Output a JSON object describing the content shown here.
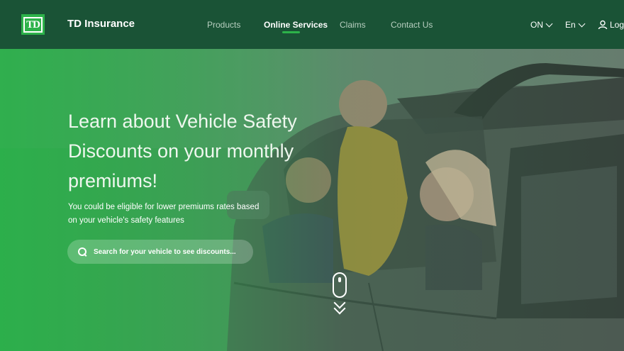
{
  "nav": {
    "logo_text": "TD",
    "brand": "TD Insurance",
    "links": [
      {
        "label": "Products"
      },
      {
        "label": "Online Services"
      },
      {
        "label": "Claims"
      },
      {
        "label": "Contact Us"
      }
    ],
    "province": "ON",
    "language": "En",
    "login": "Log"
  },
  "hero": {
    "headline": "Learn about Vehicle Safety Discounts on your monthly premiums!",
    "subtext": "You could be eligible for lower premiums rates based on your vehicle's safety features",
    "search_placeholder": "Search for your vehicle to see discounts..."
  },
  "colors": {
    "nav_bg": "#1a5336",
    "accent": "#2db24a"
  }
}
